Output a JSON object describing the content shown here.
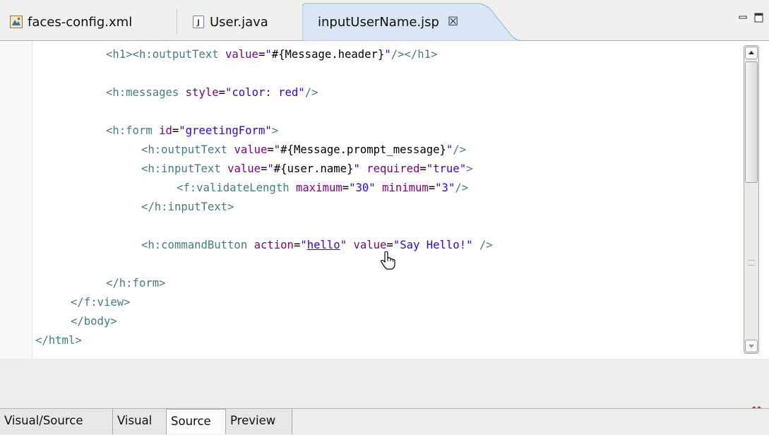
{
  "tabs": [
    {
      "label": "faces-config.xml",
      "icon": "faces-config-icon"
    },
    {
      "label": "User.java",
      "icon": "java-file-icon"
    },
    {
      "label": "inputUserName.jsp",
      "icon": "jsp-file-icon",
      "active": true,
      "close": "☒"
    }
  ],
  "code_lines": [
    {
      "parts": [
        [
          "t",
          "<h1><h:outputText "
        ],
        [
          "a",
          "value"
        ],
        [
          "p",
          "="
        ],
        [
          "v",
          "\""
        ],
        [
          "p",
          "#{Message.header}"
        ],
        [
          "v",
          "\""
        ],
        [
          "t",
          "/></h1>"
        ]
      ]
    },
    {
      "parts": [
        [
          "t",
          "<h:messages "
        ],
        [
          "a",
          "style"
        ],
        [
          "p",
          "="
        ],
        [
          "v",
          "\"color: red\""
        ],
        [
          "t",
          "/>"
        ]
      ]
    },
    {
      "parts": [
        [
          "t",
          "<h:form "
        ],
        [
          "a",
          "id"
        ],
        [
          "p",
          "="
        ],
        [
          "v",
          "\"greetingForm\""
        ],
        [
          "t",
          ">"
        ]
      ]
    },
    {
      "parts": [
        [
          "t",
          "<h:outputText "
        ],
        [
          "a",
          "value"
        ],
        [
          "p",
          "="
        ],
        [
          "v",
          "\""
        ],
        [
          "p",
          "#{Message.prompt_message}"
        ],
        [
          "v",
          "\""
        ],
        [
          "t",
          "/>"
        ]
      ]
    },
    {
      "parts": [
        [
          "t",
          "<h:inputText "
        ],
        [
          "a",
          "value"
        ],
        [
          "p",
          "="
        ],
        [
          "v",
          "\""
        ],
        [
          "p",
          "#{user.name}"
        ],
        [
          "v",
          "\""
        ],
        [
          "p",
          " "
        ],
        [
          "a",
          "required"
        ],
        [
          "p",
          "="
        ],
        [
          "v",
          "\"true\""
        ],
        [
          "t",
          ">"
        ]
      ]
    },
    {
      "parts": [
        [
          "t",
          "<f:validateLength "
        ],
        [
          "a",
          "maximum"
        ],
        [
          "p",
          "="
        ],
        [
          "v",
          "\"30\""
        ],
        [
          "p",
          " "
        ],
        [
          "a",
          "minimum"
        ],
        [
          "p",
          "="
        ],
        [
          "v",
          "\"3\""
        ],
        [
          "t",
          "/>"
        ]
      ]
    },
    {
      "parts": [
        [
          "t",
          "</h:inputText>"
        ]
      ]
    },
    {
      "parts": [
        [
          "t",
          "<h:commandButton "
        ],
        [
          "a",
          "action"
        ],
        [
          "p",
          "="
        ],
        [
          "v",
          "\""
        ],
        [
          "link",
          "hello"
        ],
        [
          "v",
          "\""
        ],
        [
          "p",
          " "
        ],
        [
          "a",
          "value"
        ],
        [
          "p",
          "="
        ],
        [
          "v",
          "\"Say Hello!\""
        ],
        [
          "p",
          " "
        ],
        [
          "t",
          "/>"
        ]
      ]
    },
    {
      "parts": [
        [
          "t",
          "</h:form>"
        ]
      ]
    },
    {
      "parts": [
        [
          "t",
          "</f:view>"
        ]
      ]
    },
    {
      "parts": [
        [
          "t",
          "</body>"
        ]
      ]
    },
    {
      "parts": [
        [
          "t",
          "</html>"
        ]
      ]
    }
  ],
  "bottom_tabs": [
    {
      "label": "Visual/Source"
    },
    {
      "label": "Visual"
    },
    {
      "label": "Source",
      "selected": true
    },
    {
      "label": "Preview"
    }
  ],
  "colors": {
    "tag": "#3f7f7f",
    "attribute": "#7f007f",
    "value": "#2a00ff",
    "error": "#e0241f",
    "active_tab": "#d9e6f6"
  },
  "icons": {
    "hand_cursor": "hand-cursor-icon",
    "error_marker": "red-x-icon",
    "minimize": "minimize-icon",
    "maximize": "maximize-icon"
  }
}
